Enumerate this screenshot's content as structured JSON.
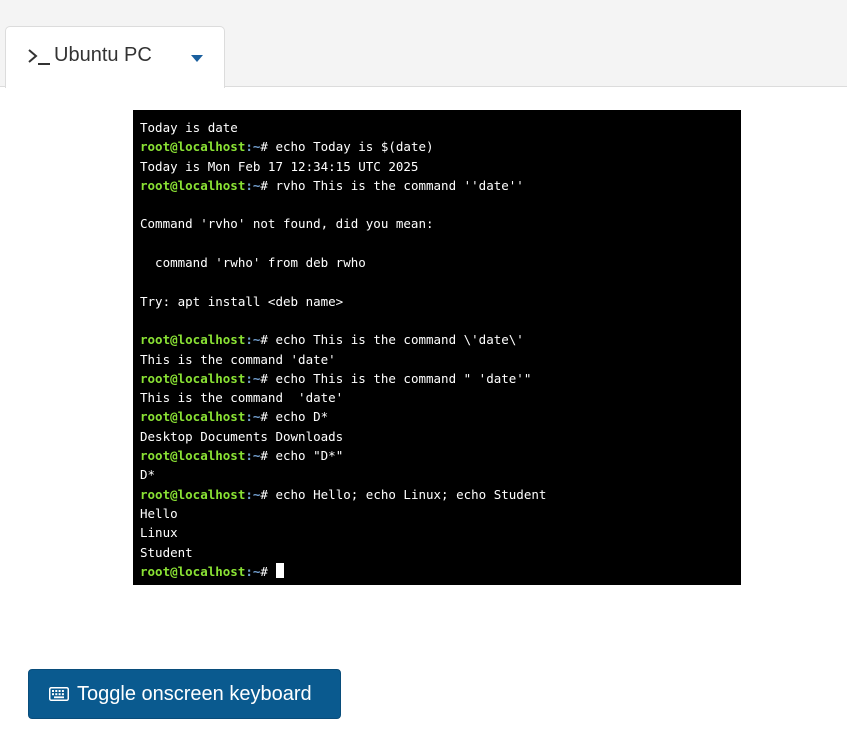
{
  "tab": {
    "label": "Ubuntu PC",
    "icon": "terminal-prompt-icon",
    "dropdown_icon": "caret-down-icon"
  },
  "terminal": {
    "prompt": {
      "user_host": "root@localhost",
      "path": ":~",
      "symbol": "# "
    },
    "lines": [
      {
        "type": "output",
        "text": "Today is date"
      },
      {
        "type": "command",
        "text": "echo Today is $(date)"
      },
      {
        "type": "output",
        "text": "Today is Mon Feb 17 12:34:15 UTC 2025"
      },
      {
        "type": "command",
        "text": "rvho This is the command ''date''"
      },
      {
        "type": "output",
        "text": ""
      },
      {
        "type": "output",
        "text": "Command 'rvho' not found, did you mean:"
      },
      {
        "type": "output",
        "text": ""
      },
      {
        "type": "output",
        "text": "  command 'rwho' from deb rwho"
      },
      {
        "type": "output",
        "text": ""
      },
      {
        "type": "output",
        "text": "Try: apt install <deb name>"
      },
      {
        "type": "output",
        "text": ""
      },
      {
        "type": "command",
        "text": "echo This is the command \\'date\\'"
      },
      {
        "type": "output",
        "text": "This is the command 'date'"
      },
      {
        "type": "command",
        "text": "echo This is the command \" 'date'\""
      },
      {
        "type": "output",
        "text": "This is the command  'date'"
      },
      {
        "type": "command",
        "text": "echo D*"
      },
      {
        "type": "output",
        "text": "Desktop Documents Downloads"
      },
      {
        "type": "command",
        "text": "echo \"D*\""
      },
      {
        "type": "output",
        "text": "D*"
      },
      {
        "type": "command",
        "text": "echo Hello; echo Linux; echo Student"
      },
      {
        "type": "output",
        "text": "Hello"
      },
      {
        "type": "output",
        "text": "Linux"
      },
      {
        "type": "output",
        "text": "Student"
      },
      {
        "type": "prompt",
        "text": ""
      }
    ]
  },
  "keyboard_button": {
    "label": "Toggle onscreen keyboard",
    "icon": "keyboard-icon"
  },
  "colors": {
    "accent": "#0a5a8f",
    "prompt_user": "#8ae234",
    "prompt_path": "#729fcf",
    "terminal_bg": "#000000"
  }
}
